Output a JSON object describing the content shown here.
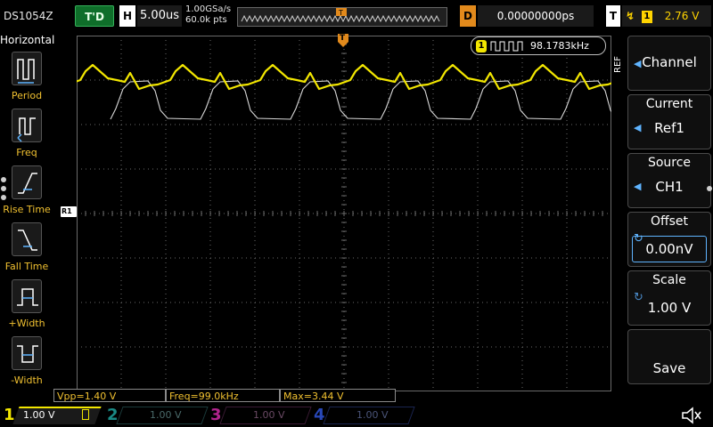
{
  "status": {
    "model": "DS1054Z",
    "trigger_status": "T'D",
    "horizontal_label": "H",
    "timebase": "5.00us",
    "sample_rate": "1.00GSa/s",
    "memory_depth": "60.0k pts",
    "delay_label": "D",
    "delay_value": "0.00000000ps",
    "trigger_label": "T",
    "trigger_source": "1",
    "trigger_level": "2.76 V"
  },
  "left_menu": {
    "title": "Horizontal",
    "items": [
      {
        "label": "Period"
      },
      {
        "label": "Freq"
      },
      {
        "label": "Rise Time"
      },
      {
        "label": "Fall Time"
      },
      {
        "label": "+Width"
      },
      {
        "label": "-Width"
      }
    ]
  },
  "display": {
    "trigger_marker": "T",
    "ref_marker": "R1",
    "freq_counter_channel": "1",
    "freq_counter": "98.1783kHz"
  },
  "right_menu": {
    "tab": "REF",
    "channel": {
      "label": "Channel"
    },
    "current": {
      "title": "Current",
      "value": "Ref1"
    },
    "source": {
      "title": "Source",
      "value": "CH1"
    },
    "offset": {
      "title": "Offset",
      "value": "0.00nV"
    },
    "scale": {
      "title": "Scale",
      "value": "1.00 V"
    },
    "save": {
      "label": "Save"
    }
  },
  "measurements": [
    {
      "text": "Vpp=1.40 V"
    },
    {
      "text": "Freq=99.0kHz"
    },
    {
      "text": "Max=3.44 V"
    }
  ],
  "channels": [
    {
      "num": "1",
      "scale": "1.00 V",
      "color": "#f2e600",
      "active": true
    },
    {
      "num": "2",
      "scale": "1.00 V",
      "color": "#1a8a86",
      "active": false
    },
    {
      "num": "3",
      "scale": "1.00 V",
      "color": "#b0248c",
      "active": false
    },
    {
      "num": "4",
      "scale": "1.00 V",
      "color": "#2848b8",
      "active": false
    }
  ],
  "colors": {
    "ch1": "#f2e600",
    "ref": "#d8d8d8",
    "grid": "#6a6a6a",
    "menu_accent": "#5fb4ff",
    "trigger_orange": "#e28a1c"
  }
}
